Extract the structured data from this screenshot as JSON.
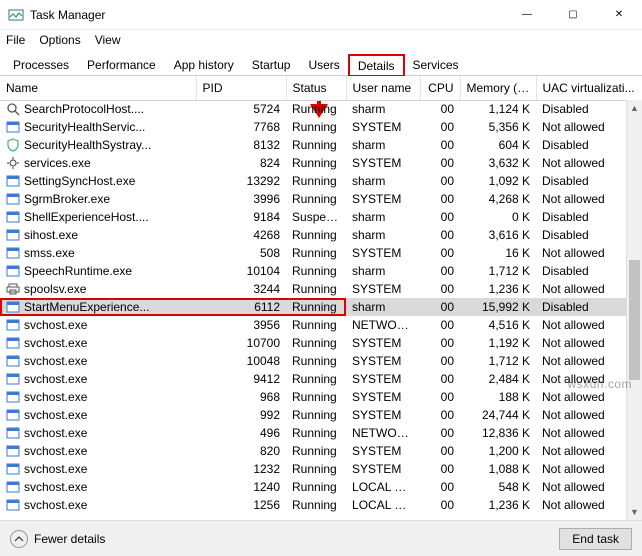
{
  "window": {
    "title": "Task Manager",
    "controls": {
      "min": "—",
      "max": "▢",
      "close": "✕"
    }
  },
  "menu": {
    "file": "File",
    "options": "Options",
    "view": "View"
  },
  "tabs": {
    "processes": "Processes",
    "performance": "Performance",
    "app_history": "App history",
    "startup": "Startup",
    "users": "Users",
    "details": "Details",
    "services": "Services"
  },
  "columns": {
    "name": "Name",
    "pid": "PID",
    "status": "Status",
    "user": "User name",
    "cpu": "CPU",
    "mem": "Memory (ac...",
    "uac": "UAC virtualizati..."
  },
  "rows": [
    {
      "icon": "search",
      "name": "SearchProtocolHost....",
      "pid": "5724",
      "status": "Running",
      "user": "sharm",
      "cpu": "00",
      "mem": "1,124 K",
      "uac": "Disabled"
    },
    {
      "icon": "exe",
      "name": "SecurityHealthServic...",
      "pid": "7768",
      "status": "Running",
      "user": "SYSTEM",
      "cpu": "00",
      "mem": "5,356 K",
      "uac": "Not allowed"
    },
    {
      "icon": "shield",
      "name": "SecurityHealthSystray...",
      "pid": "8132",
      "status": "Running",
      "user": "sharm",
      "cpu": "00",
      "mem": "604 K",
      "uac": "Disabled"
    },
    {
      "icon": "gear",
      "name": "services.exe",
      "pid": "824",
      "status": "Running",
      "user": "SYSTEM",
      "cpu": "00",
      "mem": "3,632 K",
      "uac": "Not allowed"
    },
    {
      "icon": "exe",
      "name": "SettingSyncHost.exe",
      "pid": "13292",
      "status": "Running",
      "user": "sharm",
      "cpu": "00",
      "mem": "1,092 K",
      "uac": "Disabled"
    },
    {
      "icon": "exe",
      "name": "SgrmBroker.exe",
      "pid": "3996",
      "status": "Running",
      "user": "SYSTEM",
      "cpu": "00",
      "mem": "4,268 K",
      "uac": "Not allowed"
    },
    {
      "icon": "exe",
      "name": "ShellExperienceHost....",
      "pid": "9184",
      "status": "Suspended",
      "user": "sharm",
      "cpu": "00",
      "mem": "0 K",
      "uac": "Disabled"
    },
    {
      "icon": "exe",
      "name": "sihost.exe",
      "pid": "4268",
      "status": "Running",
      "user": "sharm",
      "cpu": "00",
      "mem": "3,616 K",
      "uac": "Disabled"
    },
    {
      "icon": "exe",
      "name": "smss.exe",
      "pid": "508",
      "status": "Running",
      "user": "SYSTEM",
      "cpu": "00",
      "mem": "16 K",
      "uac": "Not allowed"
    },
    {
      "icon": "exe",
      "name": "SpeechRuntime.exe",
      "pid": "10104",
      "status": "Running",
      "user": "sharm",
      "cpu": "00",
      "mem": "1,712 K",
      "uac": "Disabled"
    },
    {
      "icon": "printer",
      "name": "spoolsv.exe",
      "pid": "3244",
      "status": "Running",
      "user": "SYSTEM",
      "cpu": "00",
      "mem": "1,236 K",
      "uac": "Not allowed"
    },
    {
      "icon": "exe",
      "name": "StartMenuExperience...",
      "pid": "6112",
      "status": "Running",
      "user": "sharm",
      "cpu": "00",
      "mem": "15,992 K",
      "uac": "Disabled",
      "selected": true,
      "highlighted": true
    },
    {
      "icon": "exe",
      "name": "svchost.exe",
      "pid": "3956",
      "status": "Running",
      "user": "NETWORK ...",
      "cpu": "00",
      "mem": "4,516 K",
      "uac": "Not allowed"
    },
    {
      "icon": "exe",
      "name": "svchost.exe",
      "pid": "10700",
      "status": "Running",
      "user": "SYSTEM",
      "cpu": "00",
      "mem": "1,192 K",
      "uac": "Not allowed"
    },
    {
      "icon": "exe",
      "name": "svchost.exe",
      "pid": "10048",
      "status": "Running",
      "user": "SYSTEM",
      "cpu": "00",
      "mem": "1,712 K",
      "uac": "Not allowed"
    },
    {
      "icon": "exe",
      "name": "svchost.exe",
      "pid": "9412",
      "status": "Running",
      "user": "SYSTEM",
      "cpu": "00",
      "mem": "2,484 K",
      "uac": "Not allowed"
    },
    {
      "icon": "exe",
      "name": "svchost.exe",
      "pid": "968",
      "status": "Running",
      "user": "SYSTEM",
      "cpu": "00",
      "mem": "188 K",
      "uac": "Not allowed"
    },
    {
      "icon": "exe",
      "name": "svchost.exe",
      "pid": "992",
      "status": "Running",
      "user": "SYSTEM",
      "cpu": "00",
      "mem": "24,744 K",
      "uac": "Not allowed"
    },
    {
      "icon": "exe",
      "name": "svchost.exe",
      "pid": "496",
      "status": "Running",
      "user": "NETWORK ...",
      "cpu": "00",
      "mem": "12,836 K",
      "uac": "Not allowed"
    },
    {
      "icon": "exe",
      "name": "svchost.exe",
      "pid": "820",
      "status": "Running",
      "user": "SYSTEM",
      "cpu": "00",
      "mem": "1,200 K",
      "uac": "Not allowed"
    },
    {
      "icon": "exe",
      "name": "svchost.exe",
      "pid": "1232",
      "status": "Running",
      "user": "SYSTEM",
      "cpu": "00",
      "mem": "1,088 K",
      "uac": "Not allowed"
    },
    {
      "icon": "exe",
      "name": "svchost.exe",
      "pid": "1240",
      "status": "Running",
      "user": "LOCAL SER...",
      "cpu": "00",
      "mem": "548 K",
      "uac": "Not allowed"
    },
    {
      "icon": "exe",
      "name": "svchost.exe",
      "pid": "1256",
      "status": "Running",
      "user": "LOCAL SER...",
      "cpu": "00",
      "mem": "1,236 K",
      "uac": "Not allowed"
    }
  ],
  "footer": {
    "fewer": "Fewer details",
    "end_task": "End task"
  },
  "watermark": "wsxdn.com"
}
